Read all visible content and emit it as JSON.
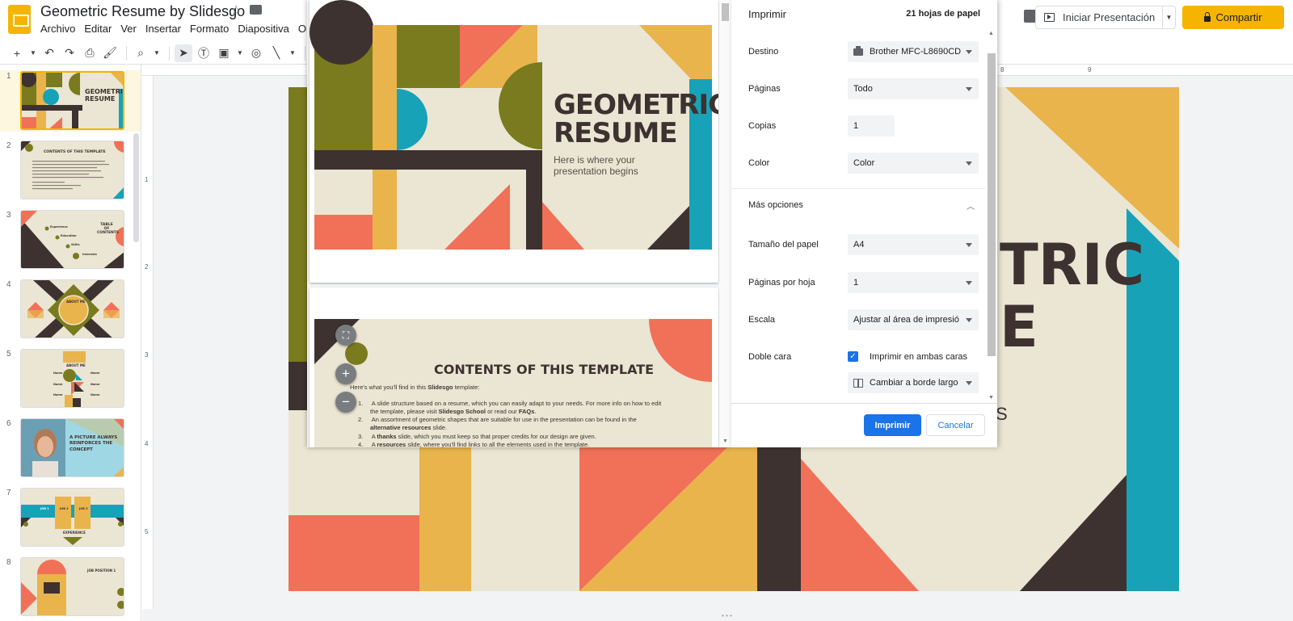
{
  "app": {
    "doc_title": "Geometric Resume by Slidesgo",
    "menu": [
      "Archivo",
      "Editar",
      "Ver",
      "Insertar",
      "Formato",
      "Diapositiva",
      "Org"
    ],
    "present_label": "Iniciar Presentación",
    "share_label": "Compartir",
    "toolbar_icons": [
      "add-icon",
      "dropdown-icon",
      "undo-icon",
      "redo-icon",
      "print-icon",
      "paint-format-icon",
      "zoom-icon",
      "dropdown-icon",
      "select-cursor-icon",
      "textbox-icon",
      "image-icon",
      "shapes-icon",
      "line-icon",
      "dropdown-icon",
      "new-comment-icon"
    ]
  },
  "filmstrip": {
    "slides": [
      {
        "num": "1",
        "label": "GEOMETRIC RESUME"
      },
      {
        "num": "2",
        "label": "CONTENTS OF THIS TEMPLATE"
      },
      {
        "num": "3",
        "label": "TABLE OF CONTENTS"
      },
      {
        "num": "4",
        "label": "ABOUT ME"
      },
      {
        "num": "5",
        "label": "ABOUT ME"
      },
      {
        "num": "6",
        "label": "A PICTURE ALWAYS REINFORCES THE CONCEPT"
      },
      {
        "num": "7",
        "label": "EXPERIENCE"
      },
      {
        "num": "8",
        "label": "JOB POSITION 1"
      }
    ],
    "thumb_texts": {
      "s3": [
        "Experience",
        "Education",
        "Skills",
        "Interests"
      ],
      "s5": [
        "Name",
        "Name",
        "Name",
        "Name",
        "Name",
        "Name"
      ],
      "s7": [
        "JOB 1",
        "JOB 2",
        "JOB 3"
      ]
    }
  },
  "rulers": {
    "top": [
      "8",
      "9"
    ],
    "left": [
      "1",
      "2",
      "3",
      "4",
      "5"
    ]
  },
  "main_slide": {
    "visible_title_line1": "TRIC",
    "visible_title_line2": "E",
    "visible_sub": "S"
  },
  "print_preview": {
    "page1": {
      "title_line1": "GEOMETRIC",
      "title_line2": "RESUME",
      "subtitle_line1": "Here is where your",
      "subtitle_line2": "presentation begins"
    },
    "page2": {
      "title": "CONTENTS OF THIS TEMPLATE",
      "intro_prefix": "Here's what you'll find in this ",
      "intro_bold": "Slidesgo",
      "intro_suffix": " template:",
      "items": [
        {
          "num": "1.",
          "text1": "A slide structure based on a resume, which you can easily adapt to your needs. For more info on how to edit",
          "text2a": "the template, please visit ",
          "bold1": "Slidesgo School",
          "text2b": " or read our ",
          "bold2": "FAQs",
          "text2c": "."
        },
        {
          "num": "2.",
          "text1": "An assortment of geometric shapes that are suitable for use in the presentation can be found in the",
          "bold1": "alternative resources",
          "text2b": " slide."
        },
        {
          "num": "3.",
          "text1a": "A ",
          "bold1": "thanks",
          "text1b": " slide, which you must keep so that proper credits for our design are given."
        },
        {
          "num": "4.",
          "text1a": "A ",
          "bold1": "resources",
          "text1b": " slide, where you'll find links to all the elements used in the template."
        }
      ]
    }
  },
  "print_settings": {
    "title": "Imprimir",
    "sheet_count": "21 hojas de papel",
    "destination_label": "Destino",
    "destination_value": "Brother MFC-L8690CD",
    "pages_label": "Páginas",
    "pages_value": "Todo",
    "copies_label": "Copias",
    "copies_value": "1",
    "color_label": "Color",
    "color_value": "Color",
    "more_options_label": "Más opciones",
    "paper_size_label": "Tamaño del papel",
    "paper_size_value": "A4",
    "pages_per_sheet_label": "Páginas por hoja",
    "pages_per_sheet_value": "1",
    "scale_label": "Escala",
    "scale_value": "Ajustar al área de impresió",
    "duplex_label": "Doble cara",
    "duplex_checkbox_label": "Imprimir en ambas caras",
    "duplex_checked": true,
    "flip_value": "Cambiar a borde largo",
    "print_button": "Imprimir",
    "cancel_button": "Cancelar"
  },
  "colors": {
    "cream": "#ebe5d3",
    "olive": "#7a7a1e",
    "brown": "#3d3230",
    "mustard": "#e9b44c",
    "coral": "#f07157",
    "teal": "#17a2b8",
    "accent_blue": "#1a73e8",
    "brand_yellow": "#f4b400"
  }
}
